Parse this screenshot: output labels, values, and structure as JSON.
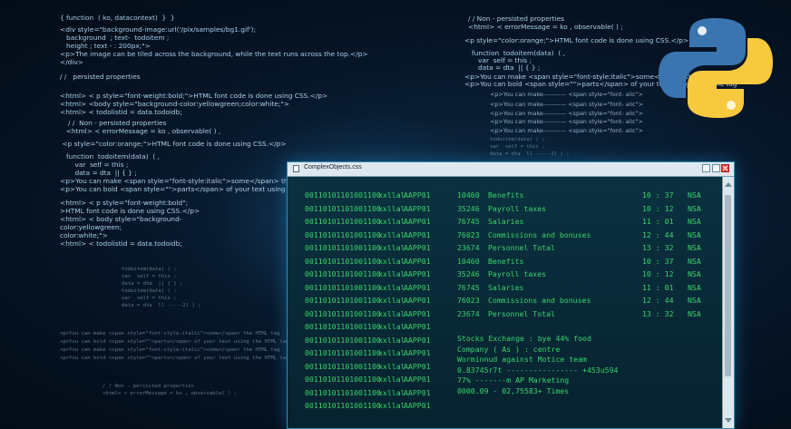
{
  "background_code": {
    "left": [
      "{ function  ( ko, datacontext)  }  }",
      "<div style=\"background-image:url('/pix/samples/bg1.gif');",
      "   background  ; text-  todoitem ;",
      "   height ; text - : 200px;\">",
      "<p>The image can be tiled across the background, while the text runs across the top.</p>",
      "</div>",
      "/ /   persisted properties",
      "<html> < p style=\"font-weight:bold;\">HTML font code is done using CSS.</p>",
      "<html> <body style=\"background-color:yellowgreen;color:white;\">",
      "<html> < todolistid = data.todoidb;",
      "   / /  Non - persisted properties",
      "  <html> < errorMessage = ko , observable( ) ,",
      " <p style=\"color:orange;\">HTML font code is done using CSS.</p>",
      "   function  todoitem(data)  ( ,",
      "       var  self = this ;",
      "       data = dta  || { } ;",
      "<p>You can make <span style=\"font-style:italic\">some</span> the HTML tag",
      "<p>You can bold <span style=\"\">parts</span> of your text using the HTML tag",
      "<html> < p style=\"font-weight:bold\";",
      ">HTML font code is done using CSS.</p>",
      "<html> < body style=\"background-",
      "color:yellowgreen;",
      "color:white;\">",
      "<html> < todolistid = data.todoidb;"
    ],
    "left_small": [
      "todoitem(data) ( ;",
      "var  self = this ;",
      "data = dta  || { } ;",
      "todoitem(data) ( ;",
      "var  self = this ;",
      "data = dta  ll -----2( ) ;"
    ],
    "bottom_left": [
      "<p>You can make <span style=\"font-style:italic\">some</span> the HTML tag",
      "<p>You can bold <span style=\"\">parts</span> of your text using the HTML tag",
      "<p>You can make <span style=\"font-style:italic\">some</span> the HTML tag",
      "<p>You can bold <span style=\"\">parts</span> of your text using the HTML tag"
    ],
    "bottom_mid": [
      "/ / Non - persisted properties",
      "<html> < errorMessage = ko , observable( ) ;"
    ],
    "right": [
      "/ / Non - persisted properties",
      "<html> < errorMessage = ko , observable( ) ;",
      "<p style=\"color:orange;\">HTML font code is done using CSS.</p>",
      "function  todoitem(data)  ( ,",
      "   var  self = this ;",
      "   data = dta  || { } ;",
      "<p>You can make <span style=\"font-style:italic\">some</span> the HTML tag",
      "<p>You can bold <span style=\"\">parts</span> of your text using the HTML tag",
      "<p>You can make----------- <span style=\"font- alic\">",
      "<p>You can make----------- <span style=\"font- alic\">",
      "<p>You can make----------- <span style=\"font- alic\">",
      "<p>You can make----------- <span style=\"font- alic\">",
      "<p>You can make----------- <span style=\"font- alic\">",
      "todoitem(data) ( ;",
      "var  self = this ;",
      "data = dta  ll -----2( ) ;"
    ]
  },
  "window": {
    "title": "ComplexObjects.css",
    "rows": [
      {
        "code": "00110101101001100",
        "x": "xxllal",
        "aap": "AAPP01",
        "num": "10460",
        "name": "Benefits",
        "time": "10  :  37",
        "nsa": "NSA"
      },
      {
        "code": "00110101101001100",
        "x": "xxllal",
        "aap": "AAPP01",
        "num": "35246",
        "name": "Payroll taxes",
        "time": "10 : 12",
        "nsa": "NSA"
      },
      {
        "code": "00110101101001100",
        "x": "xxllal",
        "aap": "AAPP01",
        "num": "76745",
        "name": "Salaries",
        "time": "11 : 01",
        "nsa": "NSA"
      },
      {
        "code": "00110101101001100",
        "x": "xxllal",
        "aap": "AAPP01",
        "num": "76023",
        "name": "Commissions and bonuses",
        "time": "12 : 44",
        "nsa": "NSA"
      },
      {
        "code": "00110101101001100",
        "x": "xxllal",
        "aap": "AAPP01",
        "num": "23674",
        "name": "Personnel Total",
        "time": "13 : 32",
        "nsa": "NSA"
      },
      {
        "code": "00110101101001100",
        "x": "xxllal",
        "aap": "AAPP01",
        "num": "10460",
        "name": "Benefits",
        "time": "10 : 37",
        "nsa": "NSA"
      },
      {
        "code": "00110101101001100",
        "x": "xxllal",
        "aap": "AAPP01",
        "num": "35246",
        "name": "Payroll taxes",
        "time": "10 : 12",
        "nsa": "NSA"
      },
      {
        "code": "00110101101001100",
        "x": "xxllal",
        "aap": "AAPP01",
        "num": "76745",
        "name": "Salaries",
        "time": "11 : 01",
        "nsa": "NSA"
      },
      {
        "code": "00110101101001100",
        "x": "xxllal",
        "aap": "AAPP01",
        "num": "76023",
        "name": "Commissions and bonuses",
        "time": "12 : 44",
        "nsa": "NSA"
      },
      {
        "code": "00110101101001100",
        "x": "xxllal",
        "aap": "AAPP01",
        "num": "23674",
        "name": "Personnel Total",
        "time": "13 : 32",
        "nsa": "NSA"
      },
      {
        "code": "00110101101001100",
        "x": "xxllal",
        "aap": "AAPP01",
        "num": "",
        "name": "",
        "time": "",
        "nsa": ""
      },
      {
        "code": "00110101101001100",
        "x": "xxllal",
        "aap": "AAPP01",
        "num": "",
        "name": "",
        "time": "",
        "nsa": ""
      },
      {
        "code": "00110101101001100",
        "x": "xxllal",
        "aap": "AAPP01",
        "num": "",
        "name": "",
        "time": "",
        "nsa": ""
      },
      {
        "code": "00110101101001100",
        "x": "xxllal",
        "aap": "AAPP01",
        "num": "",
        "name": "",
        "time": "",
        "nsa": ""
      },
      {
        "code": "00110101101001100",
        "x": "xxllal",
        "aap": "AAPP01",
        "num": "",
        "name": "",
        "time": "",
        "nsa": ""
      },
      {
        "code": "00110101101001100",
        "x": "xxllal",
        "aap": "AAPP01",
        "num": "",
        "name": "",
        "time": "",
        "nsa": ""
      },
      {
        "code": "00110101101001100",
        "x": "xxllal",
        "aap": "AAPP01",
        "num": "",
        "name": "",
        "time": "",
        "nsa": ""
      }
    ],
    "tail_lines": [
      "Stocks Exchange : bye 44% food",
      "Company ( As ) : centre",
      "Worminnud  against Motice team",
      "0.83745r7t  ---------------- +453u594",
      "77% -------m AP Marketing",
      "0000.09 - 02,75583+ Times"
    ]
  },
  "colors": {
    "terminal_text": "#39d36a",
    "code_text": "#bfe3ff",
    "python_blue": "#3a75b0",
    "python_yellow": "#f7c93e"
  },
  "icons": [
    "python-logo"
  ]
}
